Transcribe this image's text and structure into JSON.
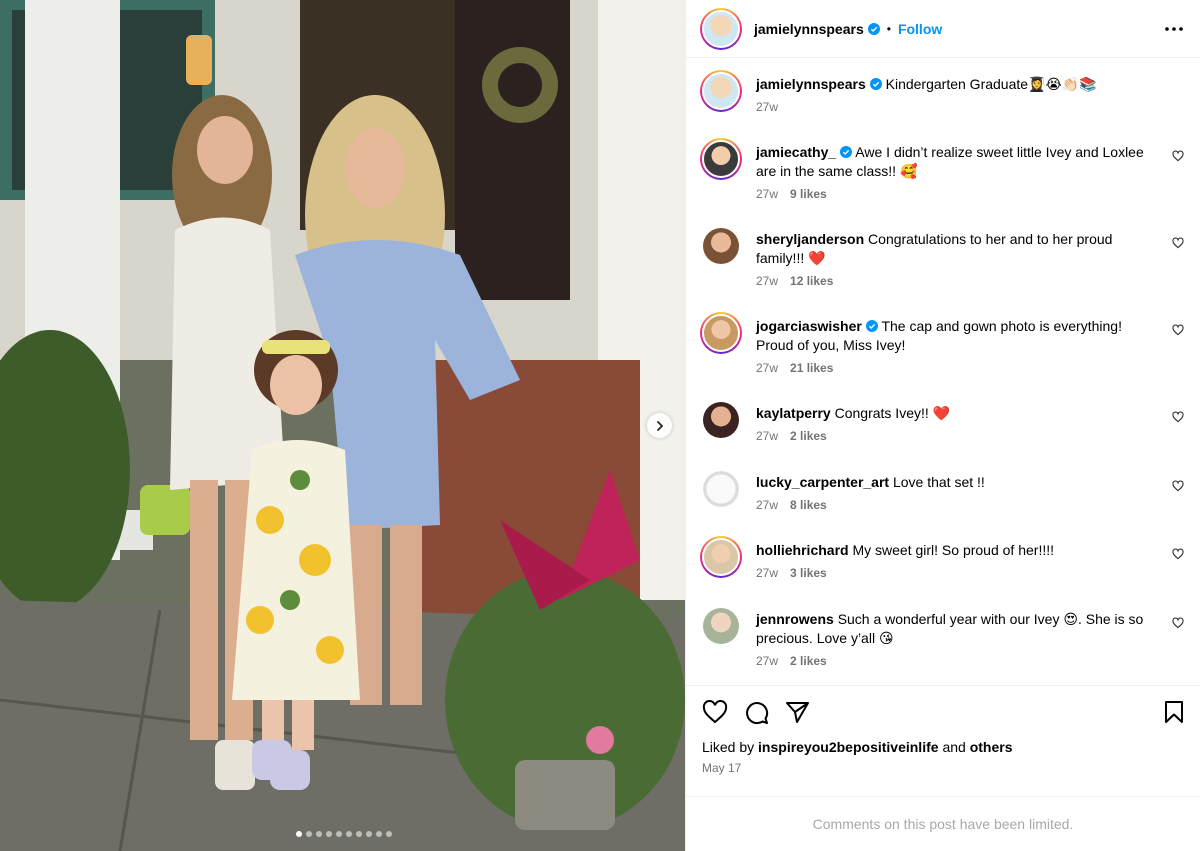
{
  "photo": {
    "description_icon": "photo-image",
    "dots_count": 10,
    "active_dot": 0
  },
  "header": {
    "username": "jamielynnspears",
    "separator": "•",
    "follow_label": "Follow"
  },
  "caption": {
    "username": "jamielynnspears",
    "text": "Kindergarten Graduate👩‍🎓😭👏🏻📚",
    "time": "27w"
  },
  "comments": [
    {
      "username": "jamiecathy_",
      "verified": true,
      "text": "Awe I didn’t realize sweet little Ivey and Loxlee are in the same class!! 🥰",
      "time": "27w",
      "likes": "9 likes"
    },
    {
      "username": "sheryljanderson",
      "verified": false,
      "text": "Congratulations to her and to her proud family!!! ❤️",
      "time": "27w",
      "likes": "12 likes"
    },
    {
      "username": "jogarciaswisher",
      "verified": true,
      "text": "The cap and gown photo is everything! Proud of you, Miss Ivey!",
      "time": "27w",
      "likes": "21 likes"
    },
    {
      "username": "kaylatperry",
      "verified": false,
      "text": "Congrats Ivey!! ❤️",
      "time": "27w",
      "likes": "2 likes"
    },
    {
      "username": "lucky_carpenter_art",
      "verified": false,
      "text": "Love that set !!",
      "time": "27w",
      "likes": "8 likes"
    },
    {
      "username": "holliehrichard",
      "verified": false,
      "text": "My sweet girl! So proud of her!!!!",
      "time": "27w",
      "likes": "3 likes"
    },
    {
      "username": "jennrowens",
      "verified": false,
      "text": "Such a wonderful year with our Ivey 😍. She is so precious. Love y’all 😘",
      "time": "27w",
      "likes": "2 likes"
    }
  ],
  "actions": {
    "liked_prefix": "Liked by",
    "liked_user": "inspireyou2bepositiveinlife",
    "liked_and": "and",
    "liked_others": "others",
    "date": "May 17"
  },
  "footer": {
    "limited_text": "Comments on this post have been limited."
  },
  "colors": {
    "accent": "#0095f6",
    "muted": "#737373",
    "verified": "#0095f6"
  }
}
